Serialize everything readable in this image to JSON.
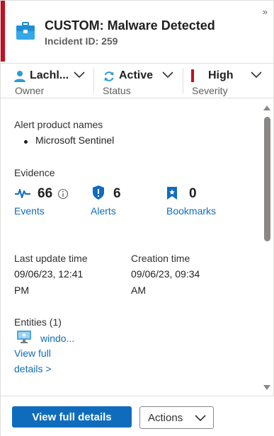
{
  "header": {
    "title": "CUSTOM: Malware Detected",
    "incident_id": "Incident ID: 259",
    "collapse_glyph": "»",
    "icon": "briefcase-icon",
    "accent_color": "#c50f1f"
  },
  "fields": {
    "owner": {
      "value": "Lachl...",
      "label": "Owner",
      "icon": "person-icon"
    },
    "status": {
      "value": "Active",
      "label": "Status",
      "icon": "refresh-icon"
    },
    "severity": {
      "value": "High",
      "label": "Severity",
      "color": "#c50f1f"
    }
  },
  "alert_products": {
    "label": "Alert product names",
    "items": [
      "Microsoft Sentinel"
    ]
  },
  "evidence": {
    "label": "Evidence",
    "events": {
      "count": "66",
      "label": "Events",
      "icon": "pulse-icon"
    },
    "alerts": {
      "count": "6",
      "label": "Alerts",
      "icon": "shield-icon"
    },
    "bookmarks": {
      "count": "0",
      "label": "Bookmarks",
      "icon": "bookmark-icon"
    }
  },
  "times": {
    "last_update_label": "Last update time",
    "last_update_line1": "09/06/23, 12:41",
    "last_update_line2": "PM",
    "creation_label": "Creation time",
    "creation_line1": "09/06/23, 09:34",
    "creation_line2": "AM"
  },
  "entities": {
    "label": "Entities (1)",
    "item": "windo...",
    "item_icon": "computer-icon",
    "view_full_line1": "View full",
    "view_full_line2": "details >"
  },
  "footer": {
    "primary_label": "View full details",
    "actions_label": "Actions"
  },
  "colors": {
    "link": "#0f6cbd",
    "primary_button": "#0f6cbd"
  }
}
